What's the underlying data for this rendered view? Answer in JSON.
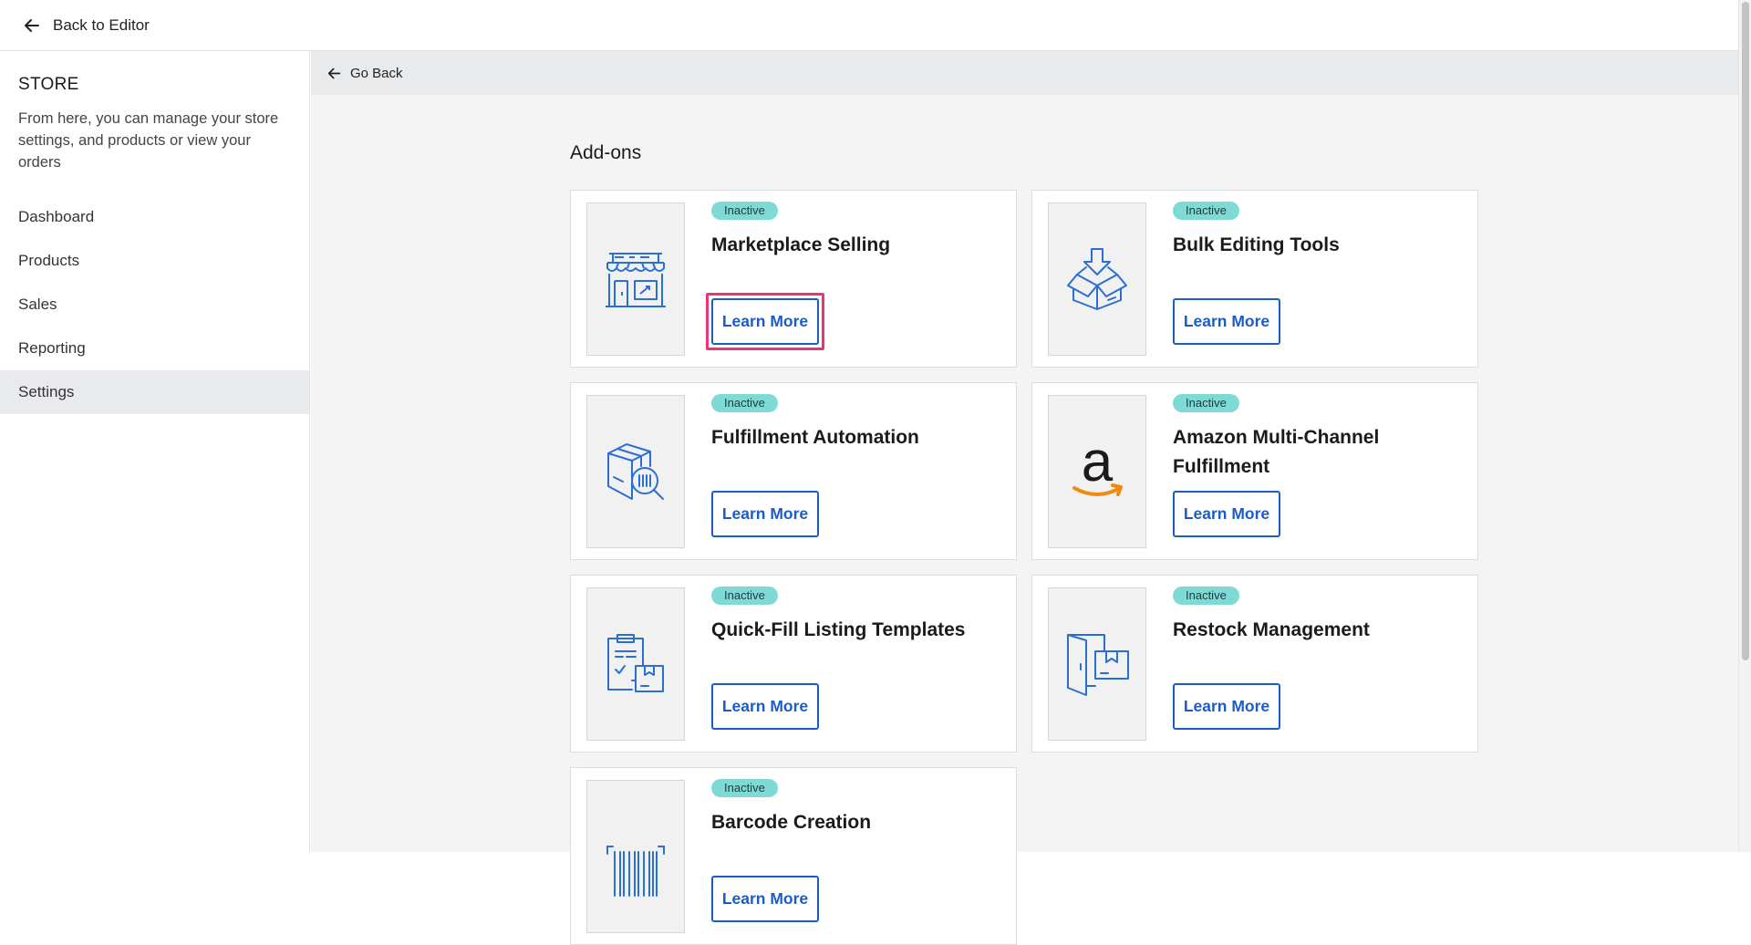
{
  "topbar": {
    "back_label": "Back to Editor"
  },
  "sidebar": {
    "title": "STORE",
    "description": "From here, you can manage your store settings, and products or view your orders",
    "items": [
      {
        "label": "Dashboard"
      },
      {
        "label": "Products"
      },
      {
        "label": "Sales"
      },
      {
        "label": "Reporting"
      },
      {
        "label": "Settings",
        "active": true
      }
    ]
  },
  "subbar": {
    "go_back_label": "Go Back"
  },
  "content": {
    "heading": "Add-ons"
  },
  "addons": [
    {
      "status": "Inactive",
      "title": "Marketplace Selling",
      "button": "Learn More",
      "icon": "storefront-icon",
      "focused": true
    },
    {
      "status": "Inactive",
      "title": "Bulk Editing Tools",
      "button": "Learn More",
      "icon": "box-download-icon"
    },
    {
      "status": "Inactive",
      "title": "Fulfillment Automation",
      "button": "Learn More",
      "icon": "package-search-icon"
    },
    {
      "status": "Inactive",
      "title": "Amazon Multi-Channel Fulfillment",
      "button": "Learn More",
      "icon": "amazon-logo-icon"
    },
    {
      "status": "Inactive",
      "title": "Quick-Fill Listing Templates",
      "button": "Learn More",
      "icon": "clipboard-template-icon"
    },
    {
      "status": "Inactive",
      "title": "Restock Management",
      "button": "Learn More",
      "icon": "restock-door-icon"
    },
    {
      "status": "Inactive",
      "title": "Barcode Creation",
      "button": "Learn More",
      "icon": "barcode-icon"
    }
  ],
  "colors": {
    "accent": "#1a5dc7",
    "badge": "#7fdad5",
    "focus": "#e8347a",
    "active_nav": "#e9eaed"
  }
}
